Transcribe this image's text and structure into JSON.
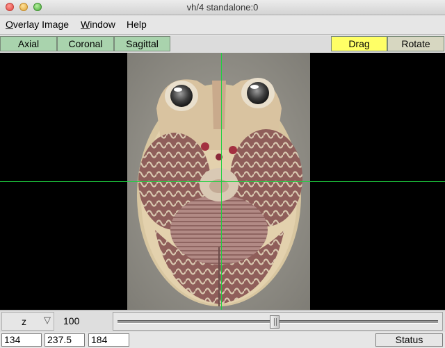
{
  "window": {
    "title": "vh/4 standalone:0"
  },
  "menu": {
    "items": [
      {
        "prefix": "",
        "accel": "O",
        "rest": "verlay Image"
      },
      {
        "prefix": "",
        "accel": "W",
        "rest": "indow"
      },
      {
        "prefix": "Help",
        "accel": "",
        "rest": ""
      }
    ]
  },
  "views": {
    "axial": "Axial",
    "coronal": "Coronal",
    "sagittal": "Sagittal",
    "drag": "Drag",
    "rotate": "Rotate"
  },
  "controls": {
    "axis": "z",
    "slider_value": "100",
    "slider_fraction": 0.49
  },
  "status": {
    "x": "134",
    "y": "237.5",
    "z": "184",
    "label": "Status"
  },
  "colors": {
    "view_button": "#a9d3ad",
    "drag_active": "#ffff66",
    "crosshair": "#1ed040"
  }
}
